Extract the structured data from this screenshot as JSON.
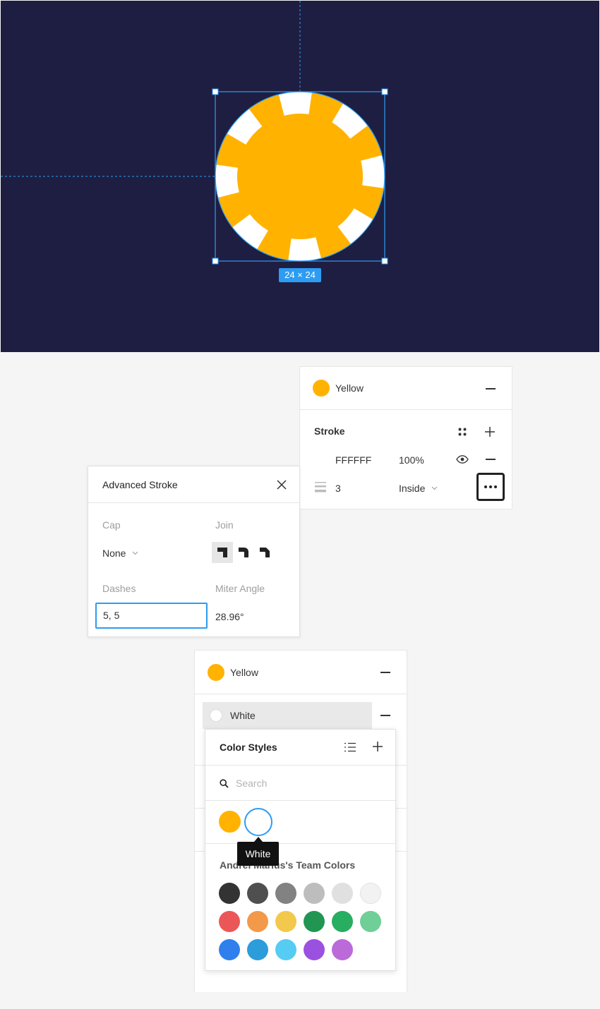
{
  "canvas": {
    "background": "#1e1e42",
    "size_label": "24 × 24",
    "chip_color": "#ffb300",
    "notch_color": "#ffffff",
    "selection_color": "#2d9cf2"
  },
  "stroke_panel": {
    "fill_name": "Yellow",
    "fill_color": "#ffb300",
    "section_title": "Stroke",
    "stroke_hex": "FFFFFF",
    "stroke_opacity": "100%",
    "stroke_weight": "3",
    "stroke_position": "Inside",
    "icons": {
      "styles": "styles-grid-icon",
      "add": "plus-icon",
      "visibility": "eye-icon",
      "remove": "minus-icon",
      "weight": "stroke-weight-icon",
      "more": "more-options-icon"
    }
  },
  "advanced_stroke": {
    "title": "Advanced Stroke",
    "cap_label": "Cap",
    "cap_value": "None",
    "join_label": "Join",
    "joins": [
      "miter",
      "round",
      "bevel"
    ],
    "selected_join": "miter",
    "dashes_label": "Dashes",
    "dashes_value": "5, 5",
    "miter_label": "Miter Angle",
    "miter_value": "28.96°"
  },
  "fill_panel": {
    "fill_name": "Yellow",
    "fill_color": "#ffb300",
    "second_fill_name": "White",
    "second_fill_color": "#ffffff"
  },
  "color_styles": {
    "title": "Color Styles",
    "search_placeholder": "Search",
    "local_styles": [
      {
        "name": "Yellow",
        "color": "#ffb300"
      },
      {
        "name": "White",
        "color": "#ffffff"
      }
    ],
    "tooltip": "White",
    "team_title": "Andrei Marius's Team Colors",
    "team_colors": [
      "#333333",
      "#4f4f4f",
      "#828282",
      "#bdbdbd",
      "#e0e0e0",
      "#f2f2f2",
      "#eb5757",
      "#f2994a",
      "#f2c94c",
      "#219653",
      "#27ae60",
      "#6fcf97",
      "#2f80ed",
      "#2d9cdb",
      "#56ccf2",
      "#9b51e0",
      "#bb6bd9"
    ]
  }
}
